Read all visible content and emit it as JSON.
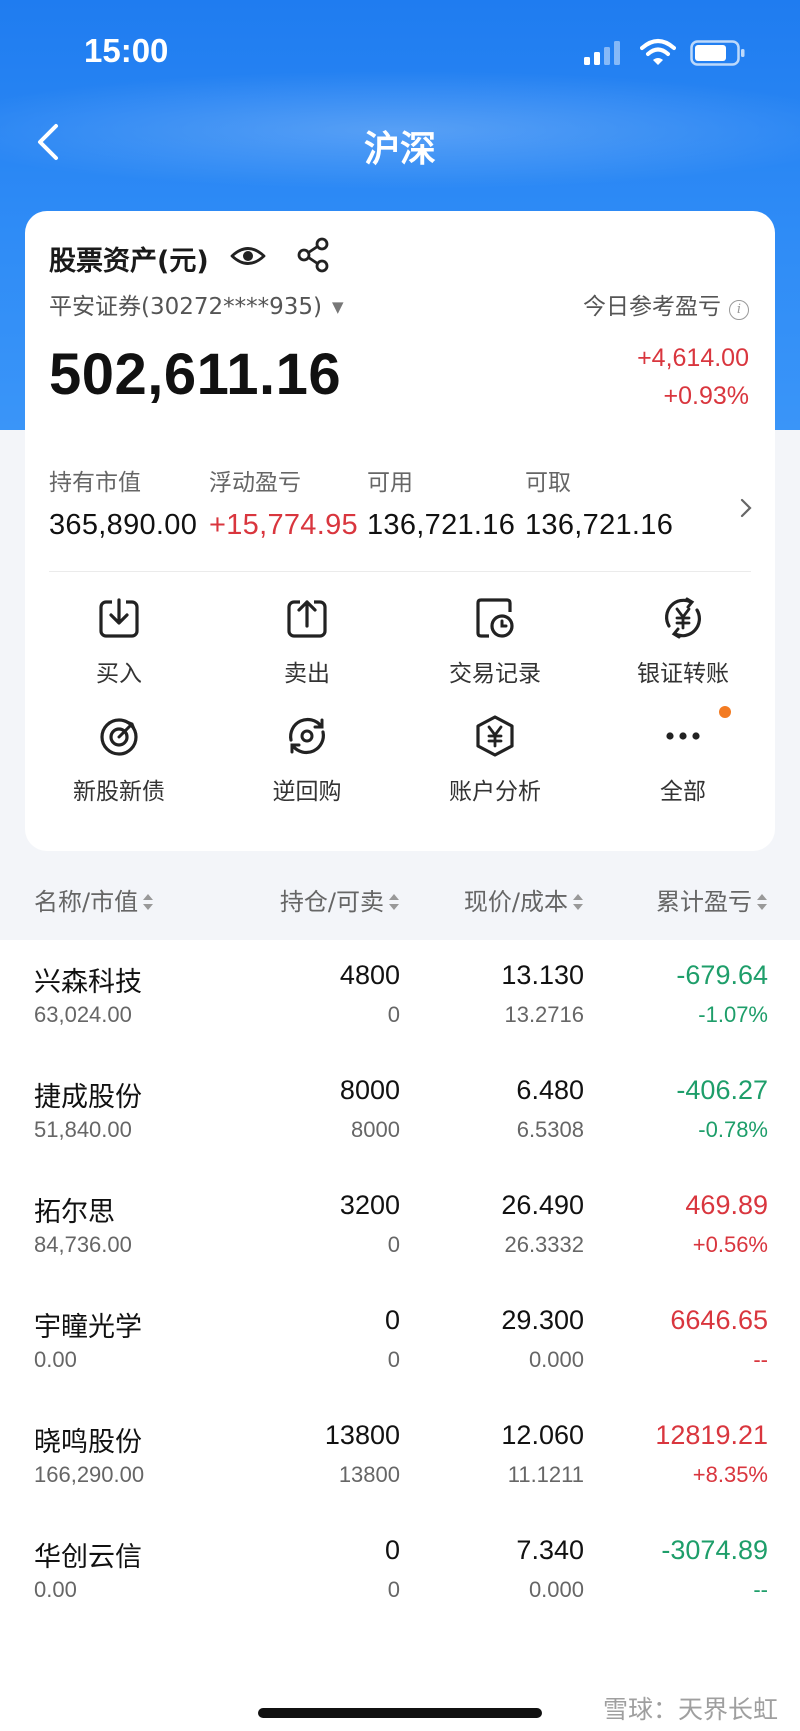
{
  "status_bar": {
    "time": "15:00"
  },
  "nav": {
    "title": "沪深"
  },
  "card": {
    "asset_title": "股票资产(元)",
    "account": "平安证券(30272****935)",
    "today_label": "今日参考盈亏",
    "total_assets": "502,611.16",
    "today_pl_amount": "+4,614.00",
    "today_pl_percent": "+0.93%",
    "stats": [
      {
        "label": "持有市值",
        "value": "365,890.00"
      },
      {
        "label": "浮动盈亏",
        "value": "+15,774.95"
      },
      {
        "label": "可用",
        "value": "136,721.16"
      },
      {
        "label": "可取",
        "value": "136,721.16"
      }
    ],
    "actions": [
      {
        "label": "买入",
        "icon": "buy-icon"
      },
      {
        "label": "卖出",
        "icon": "sell-icon"
      },
      {
        "label": "交易记录",
        "icon": "trade-record-icon"
      },
      {
        "label": "银证转账",
        "icon": "bank-transfer-icon"
      },
      {
        "label": "新股新债",
        "icon": "ipo-icon"
      },
      {
        "label": "逆回购",
        "icon": "reverse-repo-icon"
      },
      {
        "label": "账户分析",
        "icon": "account-analysis-icon"
      },
      {
        "label": "全部",
        "icon": "more-icon"
      }
    ]
  },
  "list": {
    "headers": [
      "名称/市值",
      "持仓/可卖",
      "现价/成本",
      "累计盈亏"
    ],
    "rows": [
      {
        "name": "兴森科技",
        "market_value": "63,024.00",
        "position": "4800",
        "sellable": "0",
        "price": "13.130",
        "cost": "13.2716",
        "pl": "-679.64",
        "pl_pct": "-1.07%"
      },
      {
        "name": "捷成股份",
        "market_value": "51,840.00",
        "position": "8000",
        "sellable": "8000",
        "price": "6.480",
        "cost": "6.5308",
        "pl": "-406.27",
        "pl_pct": "-0.78%"
      },
      {
        "name": "拓尔思",
        "market_value": "84,736.00",
        "position": "3200",
        "sellable": "0",
        "price": "26.490",
        "cost": "26.3332",
        "pl": "469.89",
        "pl_pct": "+0.56%"
      },
      {
        "name": "宇瞳光学",
        "market_value": "0.00",
        "position": "0",
        "sellable": "0",
        "price": "29.300",
        "cost": "0.000",
        "pl": "6646.65",
        "pl_pct": "--"
      },
      {
        "name": "晓鸣股份",
        "market_value": "166,290.00",
        "position": "13800",
        "sellable": "13800",
        "price": "12.060",
        "cost": "11.1211",
        "pl": "12819.21",
        "pl_pct": "+8.35%"
      },
      {
        "name": "华创云信",
        "market_value": "0.00",
        "position": "0",
        "sellable": "0",
        "price": "7.340",
        "cost": "0.000",
        "pl": "-3074.89",
        "pl_pct": "--"
      }
    ]
  },
  "watermark": "雪球：天界长虹",
  "colors": {
    "accent": "#2f8cf6",
    "up": "#d9363e",
    "down": "#1e9e6a",
    "badge": "#f37b22"
  }
}
